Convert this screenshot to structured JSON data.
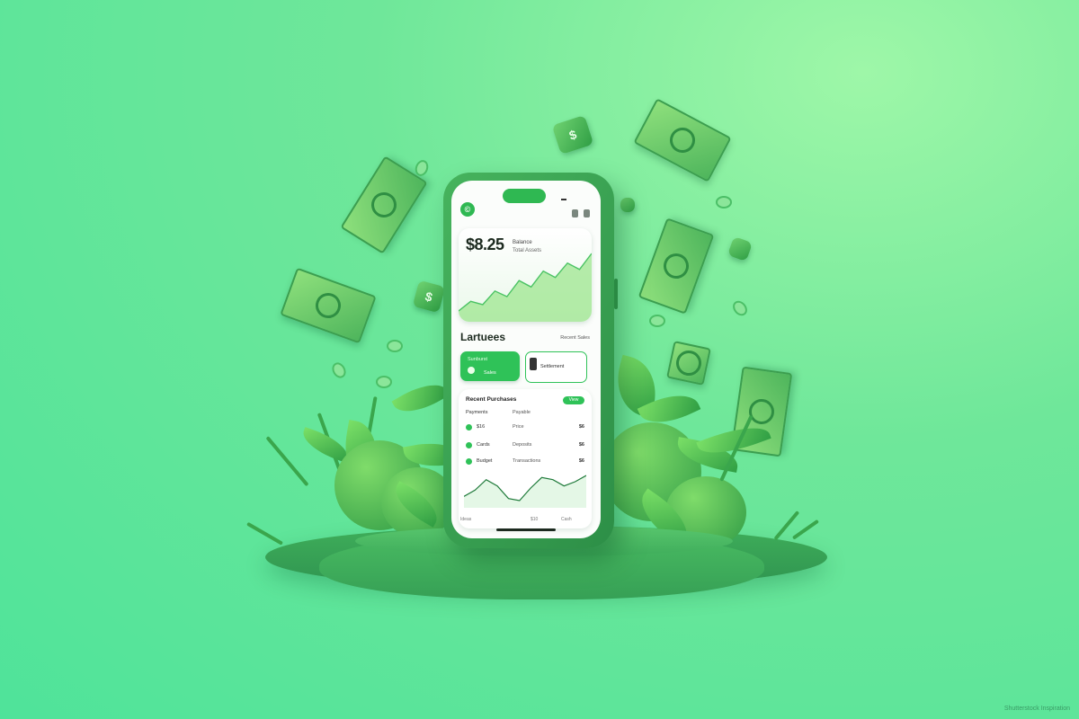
{
  "app": {
    "logo_glyph": "©",
    "balance": "$8.25",
    "balance_caption": "Balance",
    "balance_sub": "Total Assets",
    "section_title": "Lartuees",
    "section_link": "Recent Sales",
    "action_primary_top": "Sunburst",
    "action_primary_bottom": "Sales",
    "action_secondary": "Settlement",
    "list_title": "Recent Purchases",
    "list_pill": "View",
    "rows": [
      {
        "name": "Payments",
        "mid": "Payable",
        "amt": ""
      },
      {
        "name": "$16",
        "mid": "Price",
        "amt": "$6"
      },
      {
        "name": "Cards",
        "mid": "Deposits",
        "amt": "$6"
      },
      {
        "name": "Budget",
        "mid": "Transactions",
        "amt": "$6"
      }
    ],
    "footer_text": "Ideas",
    "footer_mid": "$10",
    "footer_right": "Cash"
  },
  "watermark": "Shutterstock Inspiration",
  "colors": {
    "accent": "#2fc258",
    "phone_body": "#3aa352",
    "background": "#4fe39a"
  },
  "chart_data": [
    {
      "type": "area",
      "series": [
        {
          "values": [
            10,
            22,
            18,
            35,
            28,
            48,
            40,
            60,
            52,
            70,
            62,
            82
          ]
        }
      ]
    },
    {
      "type": "line",
      "series": [
        {
          "values": [
            14,
            20,
            30,
            24,
            12,
            10,
            22,
            32,
            30,
            24,
            28,
            34
          ]
        }
      ]
    }
  ]
}
